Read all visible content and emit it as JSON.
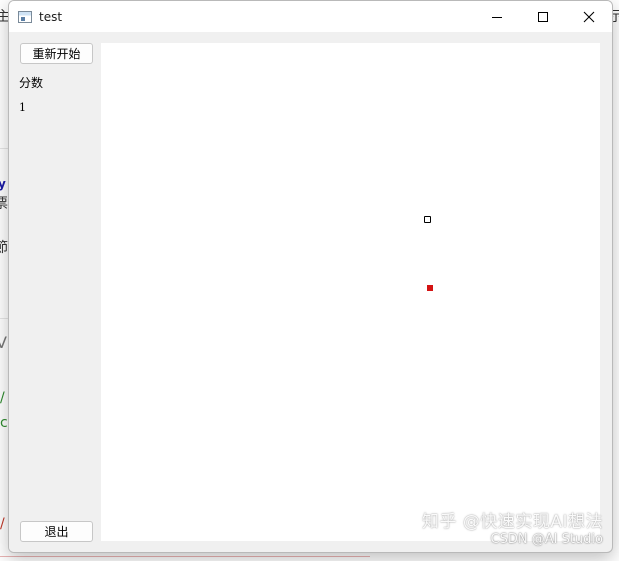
{
  "window": {
    "title": "test"
  },
  "controls": {
    "restart_label": "重新开始",
    "score_label": "分数",
    "score_value": "1",
    "quit_label": "退出"
  },
  "background_fragments": {
    "top_left_char": "主",
    "top_right_char": "示",
    "code_char_1": "y",
    "code_char_2": "票",
    "code_char_3": "節",
    "code_char_4": "V",
    "code_char_5": "/",
    "code_char_6": "c",
    "code_char_7": "/"
  },
  "watermark": {
    "line1": "知乎 @快速实现AI想法",
    "line2": "CSDN @AI Studio"
  },
  "colors": {
    "food": "#d41313",
    "snake": "#000000",
    "panel_bg": "#f0f0f0",
    "board_bg": "#ffffff"
  },
  "icons": {
    "app": "app-window-icon",
    "minimize": "minimize-icon",
    "maximize": "maximize-icon",
    "close": "close-icon"
  }
}
